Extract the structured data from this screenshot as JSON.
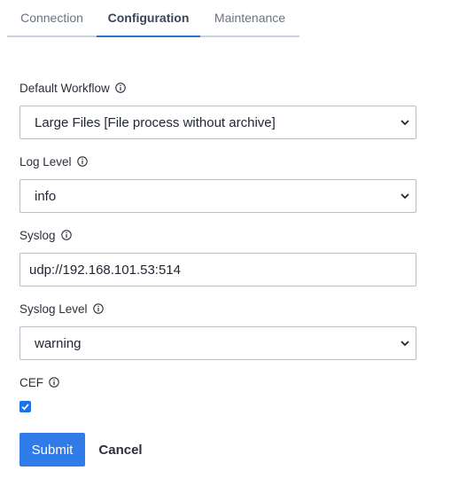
{
  "tabs": [
    {
      "label": "Connection",
      "active": false
    },
    {
      "label": "Configuration",
      "active": true
    },
    {
      "label": "Maintenance",
      "active": false
    }
  ],
  "form": {
    "default_workflow": {
      "label": "Default Workflow",
      "value": "Large Files [File process without archive]"
    },
    "log_level": {
      "label": "Log Level",
      "value": "info"
    },
    "syslog": {
      "label": "Syslog",
      "value": "udp://192.168.101.53:514"
    },
    "syslog_level": {
      "label": "Syslog Level",
      "value": "warning"
    },
    "cef": {
      "label": "CEF",
      "checked": true
    }
  },
  "buttons": {
    "submit": "Submit",
    "cancel": "Cancel"
  },
  "colors": {
    "accent": "#2f7be8",
    "tab_active_underline": "#2f6fd6",
    "checkbox": "#1a73e8"
  },
  "icons": {
    "info": "info-circle-icon",
    "select": "chevron-down-icon",
    "check": "checkmark-icon"
  }
}
